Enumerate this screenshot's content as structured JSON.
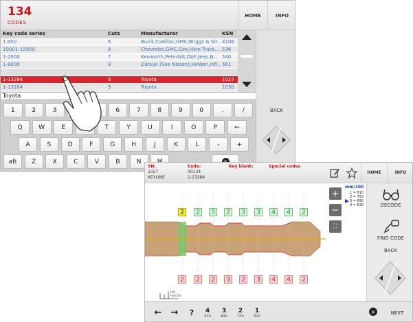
{
  "screen1": {
    "codes_count": "134",
    "codes_label": "CODES",
    "home_label": "HOME",
    "info_label": "INFO",
    "table": {
      "headers": [
        "Key code series",
        "Cuts",
        "Manufacturer",
        "KSN"
      ],
      "rows": [
        [
          "1 600",
          "6",
          "Buick,Cadillac,GMC,Briggs & Str...",
          "4106"
        ],
        [
          "10001-15000",
          "8",
          "Chevrolet,GMC,Geo,Hino Truck,...",
          "536"
        ],
        [
          "1-2000",
          "7",
          "Kenworth,Peterbilt,DAF,Jeep,N...",
          "540"
        ],
        [
          "1-8000",
          "8",
          "Datsun (See Nissan),Holden,Infi...",
          "561"
        ],
        [
          "1-13284",
          "9",
          "Toyota",
          "1027"
        ],
        [
          "1-13284",
          "9",
          "Toyota",
          "1030"
        ]
      ],
      "selected_index": 4
    },
    "search_value": "Toyota",
    "keyboard": {
      "row1": [
        "1",
        "2",
        "3",
        "4",
        "5",
        "6",
        "7",
        "8",
        "9",
        "0",
        ".",
        "/"
      ],
      "row2": [
        "Q",
        "W",
        "E",
        "R",
        "T",
        "Y",
        "U",
        "I",
        "O",
        "P",
        "←"
      ],
      "row3": [
        "A",
        "S",
        "D",
        "F",
        "G",
        "H",
        "J",
        "K",
        "L",
        "-",
        "+"
      ],
      "row4": [
        "alt",
        "Z",
        "X",
        "C",
        "V",
        "B",
        "N",
        "M"
      ]
    },
    "back_label": "BACK"
  },
  "screen2": {
    "sn_label": "SN:",
    "sn_value1": "1027",
    "sn_value2": "KEYLINE",
    "code_label": "Code:",
    "code_value1": "00134",
    "code_value2": "1-13284",
    "key_blank_label": "Key blank:",
    "special_codes_label": "Special codes",
    "home_label": "HOME",
    "info_label": "INFO",
    "unit_label": "mm/100",
    "depths": [
      "1 = 810",
      "2 = 750",
      "3 = 690",
      "4 = 630"
    ],
    "cuts_top": [
      "2",
      "2",
      "3",
      "2",
      "3",
      "3",
      "4",
      "4",
      "2"
    ],
    "cuts_bottom": [
      "2",
      "2",
      "2",
      "3",
      "2",
      "3",
      "4",
      "4",
      "2"
    ],
    "current_cut_index": 0,
    "side": {
      "decode_label": "DECODE",
      "find_code_label": "FIND CODE",
      "back_label": "BACK"
    },
    "scale_label": "100 mm/100",
    "bottom_values": [
      {
        "num": "4",
        "sub": "630"
      },
      {
        "num": "3",
        "sub": "690"
      },
      {
        "num": "2",
        "sub": "750"
      },
      {
        "num": "1",
        "sub": "810"
      }
    ],
    "question_label": "?",
    "next_label": "NEXT"
  },
  "colors": {
    "accent_red": "#c4161c",
    "row_selected": "#d7262d",
    "link_blue": "#3d74b5",
    "cut_green": "#6cc07a",
    "cut_red": "#d97b80",
    "key_brown": "#c9a27a",
    "center_line": "#f2a900"
  }
}
